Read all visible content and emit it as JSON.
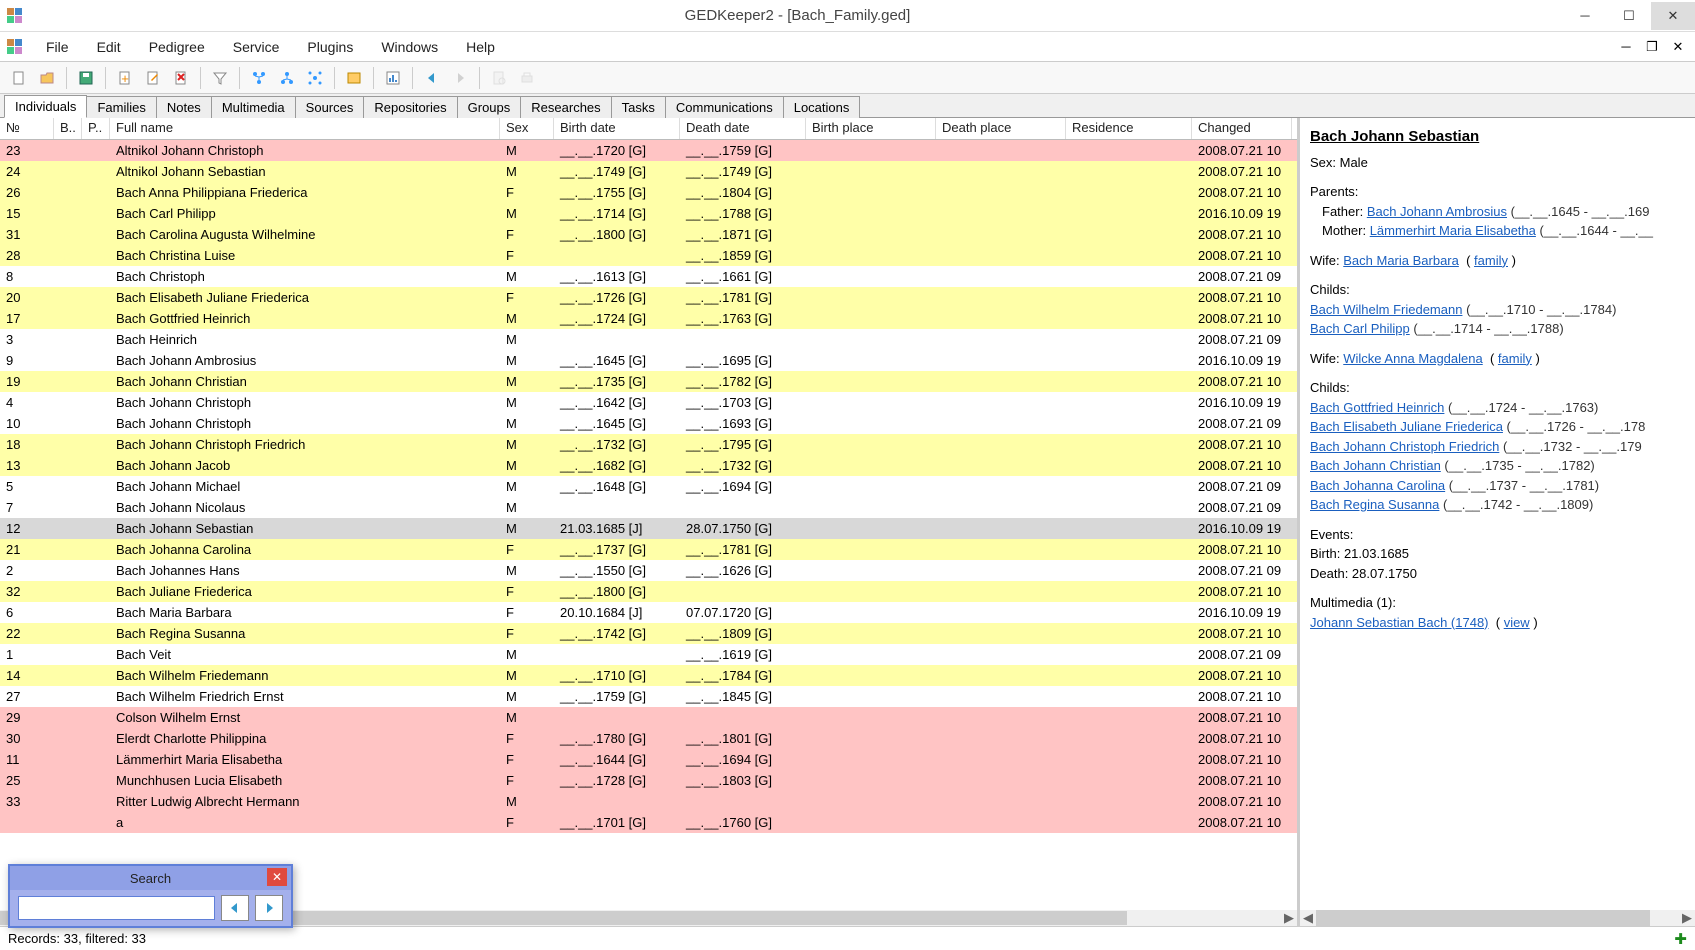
{
  "window": {
    "title": "GEDKeeper2 - [Bach_Family.ged]"
  },
  "menu": [
    "File",
    "Edit",
    "Pedigree",
    "Service",
    "Plugins",
    "Windows",
    "Help"
  ],
  "tabs": [
    "Individuals",
    "Families",
    "Notes",
    "Multimedia",
    "Sources",
    "Repositories",
    "Groups",
    "Researches",
    "Tasks",
    "Communications",
    "Locations"
  ],
  "columns": [
    "№",
    "B..",
    "P..",
    "Full name",
    "Sex",
    "Birth date",
    "Death date",
    "Birth place",
    "Death place",
    "Residence",
    "Changed"
  ],
  "rows": [
    {
      "no": "23",
      "name": "Altnikol Johann Christoph",
      "sex": "M",
      "bd": "__.__.1720 [G]",
      "dd": "__.__.1759 [G]",
      "chg": "2008.07.21 10",
      "color": "pink"
    },
    {
      "no": "24",
      "name": "Altnikol Johann Sebastian",
      "sex": "M",
      "bd": "__.__.1749 [G]",
      "dd": "__.__.1749 [G]",
      "chg": "2008.07.21 10",
      "color": "yellow"
    },
    {
      "no": "26",
      "name": "Bach Anna Philippiana Friederica",
      "sex": "F",
      "bd": "__.__.1755 [G]",
      "dd": "__.__.1804 [G]",
      "chg": "2008.07.21 10",
      "color": "yellow"
    },
    {
      "no": "15",
      "name": "Bach Carl Philipp",
      "sex": "M",
      "bd": "__.__.1714 [G]",
      "dd": "__.__.1788 [G]",
      "chg": "2016.10.09 19",
      "color": "yellow"
    },
    {
      "no": "31",
      "name": "Bach Carolina Augusta Wilhelmine",
      "sex": "F",
      "bd": "__.__.1800 [G]",
      "dd": "__.__.1871 [G]",
      "chg": "2008.07.21 10",
      "color": "yellow"
    },
    {
      "no": "28",
      "name": "Bach Christina Luise",
      "sex": "F",
      "bd": "",
      "dd": "__.__.1859 [G]",
      "chg": "2008.07.21 10",
      "color": "yellow"
    },
    {
      "no": "8",
      "name": "Bach Christoph",
      "sex": "M",
      "bd": "__.__.1613 [G]",
      "dd": "__.__.1661 [G]",
      "chg": "2008.07.21 09",
      "color": "white"
    },
    {
      "no": "20",
      "name": "Bach Elisabeth Juliane Friederica",
      "sex": "F",
      "bd": "__.__.1726 [G]",
      "dd": "__.__.1781 [G]",
      "chg": "2008.07.21 10",
      "color": "yellow"
    },
    {
      "no": "17",
      "name": "Bach Gottfried Heinrich",
      "sex": "M",
      "bd": "__.__.1724 [G]",
      "dd": "__.__.1763 [G]",
      "chg": "2008.07.21 10",
      "color": "yellow"
    },
    {
      "no": "3",
      "name": "Bach Heinrich",
      "sex": "M",
      "bd": "",
      "dd": "",
      "chg": "2008.07.21 09",
      "color": "white"
    },
    {
      "no": "9",
      "name": "Bach Johann Ambrosius",
      "sex": "M",
      "bd": "__.__.1645 [G]",
      "dd": "__.__.1695 [G]",
      "chg": "2016.10.09 19",
      "color": "white"
    },
    {
      "no": "19",
      "name": "Bach Johann Christian",
      "sex": "M",
      "bd": "__.__.1735 [G]",
      "dd": "__.__.1782 [G]",
      "chg": "2008.07.21 10",
      "color": "yellow"
    },
    {
      "no": "4",
      "name": "Bach Johann Christoph",
      "sex": "M",
      "bd": "__.__.1642 [G]",
      "dd": "__.__.1703 [G]",
      "chg": "2016.10.09 19",
      "color": "white"
    },
    {
      "no": "10",
      "name": "Bach Johann Christoph",
      "sex": "M",
      "bd": "__.__.1645 [G]",
      "dd": "__.__.1693 [G]",
      "chg": "2008.07.21 09",
      "color": "white"
    },
    {
      "no": "18",
      "name": "Bach Johann Christoph Friedrich",
      "sex": "M",
      "bd": "__.__.1732 [G]",
      "dd": "__.__.1795 [G]",
      "chg": "2008.07.21 10",
      "color": "yellow"
    },
    {
      "no": "13",
      "name": "Bach Johann Jacob",
      "sex": "M",
      "bd": "__.__.1682 [G]",
      "dd": "__.__.1732 [G]",
      "chg": "2008.07.21 10",
      "color": "yellow"
    },
    {
      "no": "5",
      "name": "Bach Johann Michael",
      "sex": "M",
      "bd": "__.__.1648 [G]",
      "dd": "__.__.1694 [G]",
      "chg": "2008.07.21 09",
      "color": "white"
    },
    {
      "no": "7",
      "name": "Bach Johann Nicolaus",
      "sex": "M",
      "bd": "",
      "dd": "",
      "chg": "2008.07.21 09",
      "color": "white"
    },
    {
      "no": "12",
      "name": "Bach Johann Sebastian",
      "sex": "M",
      "bd": "21.03.1685 [J]",
      "dd": "28.07.1750 [G]",
      "chg": "2016.10.09 19",
      "color": "selected"
    },
    {
      "no": "21",
      "name": "Bach Johanna Carolina",
      "sex": "F",
      "bd": "__.__.1737 [G]",
      "dd": "__.__.1781 [G]",
      "chg": "2008.07.21 10",
      "color": "yellow"
    },
    {
      "no": "2",
      "name": "Bach Johannes Hans",
      "sex": "M",
      "bd": "__.__.1550 [G]",
      "dd": "__.__.1626 [G]",
      "chg": "2008.07.21 09",
      "color": "white"
    },
    {
      "no": "32",
      "name": "Bach Juliane Friederica",
      "sex": "F",
      "bd": "__.__.1800 [G]",
      "dd": "",
      "chg": "2008.07.21 10",
      "color": "yellow"
    },
    {
      "no": "6",
      "name": "Bach Maria Barbara",
      "sex": "F",
      "bd": "20.10.1684 [J]",
      "dd": "07.07.1720 [G]",
      "chg": "2016.10.09 19",
      "color": "white"
    },
    {
      "no": "22",
      "name": "Bach Regina Susanna",
      "sex": "F",
      "bd": "__.__.1742 [G]",
      "dd": "__.__.1809 [G]",
      "chg": "2008.07.21 10",
      "color": "yellow"
    },
    {
      "no": "1",
      "name": "Bach Veit",
      "sex": "M",
      "bd": "",
      "dd": "__.__.1619 [G]",
      "chg": "2008.07.21 09",
      "color": "white"
    },
    {
      "no": "14",
      "name": "Bach Wilhelm Friedemann",
      "sex": "M",
      "bd": "__.__.1710 [G]",
      "dd": "__.__.1784 [G]",
      "chg": "2008.07.21 10",
      "color": "yellow"
    },
    {
      "no": "27",
      "name": "Bach Wilhelm Friedrich Ernst",
      "sex": "M",
      "bd": "__.__.1759 [G]",
      "dd": "__.__.1845 [G]",
      "chg": "2008.07.21 10",
      "color": "white"
    },
    {
      "no": "29",
      "name": "Colson Wilhelm Ernst",
      "sex": "M",
      "bd": "",
      "dd": "",
      "chg": "2008.07.21 10",
      "color": "pink"
    },
    {
      "no": "30",
      "name": "Elerdt Charlotte Philippina",
      "sex": "F",
      "bd": "__.__.1780 [G]",
      "dd": "__.__.1801 [G]",
      "chg": "2008.07.21 10",
      "color": "pink"
    },
    {
      "no": "11",
      "name": "Lämmerhirt Maria Elisabetha",
      "sex": "F",
      "bd": "__.__.1644 [G]",
      "dd": "__.__.1694 [G]",
      "chg": "2008.07.21 10",
      "color": "pink"
    },
    {
      "no": "25",
      "name": "Munchhusen Lucia Elisabeth",
      "sex": "F",
      "bd": "__.__.1728 [G]",
      "dd": "__.__.1803 [G]",
      "chg": "2008.07.21 10",
      "color": "pink"
    },
    {
      "no": "33",
      "name": "Ritter Ludwig Albrecht Hermann",
      "sex": "M",
      "bd": "",
      "dd": "",
      "chg": "2008.07.21 10",
      "color": "pink"
    },
    {
      "no": "",
      "name": "a",
      "sex": "F",
      "bd": "__.__.1701 [G]",
      "dd": "__.__.1760 [G]",
      "chg": "2008.07.21 10",
      "color": "pink"
    }
  ],
  "detail": {
    "name": "Bach Johann Sebastian",
    "sex_label": "Sex: Male",
    "parents_label": "Parents:",
    "father_label": "Father:",
    "father_link": "Bach Johann Ambrosius",
    "father_life": "(__.__.1645 - __.__.169",
    "mother_label": "Mother:",
    "mother_link": "Lämmerhirt Maria Elisabetha",
    "mother_life": "(__.__.1644 - __.__",
    "wife1_label": "Wife:",
    "wife1_link": "Bach Maria Barbara",
    "family_label": "family",
    "childs_label": "Childs:",
    "wife1_children": [
      {
        "link": "Bach Wilhelm Friedemann",
        "life": "(__.__.1710 - __.__.1784)"
      },
      {
        "link": "Bach Carl Philipp",
        "life": "(__.__.1714 - __.__.1788)"
      }
    ],
    "wife2_link": "Wilcke Anna Magdalena",
    "wife2_children": [
      {
        "link": "Bach Gottfried Heinrich",
        "life": "(__.__.1724 - __.__.1763)"
      },
      {
        "link": "Bach Elisabeth Juliane Friederica",
        "life": "(__.__.1726 - __.__.178"
      },
      {
        "link": "Bach Johann Christoph Friedrich",
        "life": "(__.__.1732 - __.__.179"
      },
      {
        "link": "Bach Johann Christian",
        "life": "(__.__.1735 - __.__.1782)"
      },
      {
        "link": "Bach Johanna Carolina",
        "life": "(__.__.1737 - __.__.1781)"
      },
      {
        "link": "Bach Regina Susanna",
        "life": "(__.__.1742 - __.__.1809)"
      }
    ],
    "events_label": "Events:",
    "birth_event": "Birth: 21.03.1685",
    "death_event": "Death: 28.07.1750",
    "multimedia_label": "Multimedia (1):",
    "multimedia_link": "Johann Sebastian Bach (1748)",
    "view_label": "view"
  },
  "search": {
    "title": "Search",
    "value": ""
  },
  "status": "Records: 33, filtered: 33"
}
